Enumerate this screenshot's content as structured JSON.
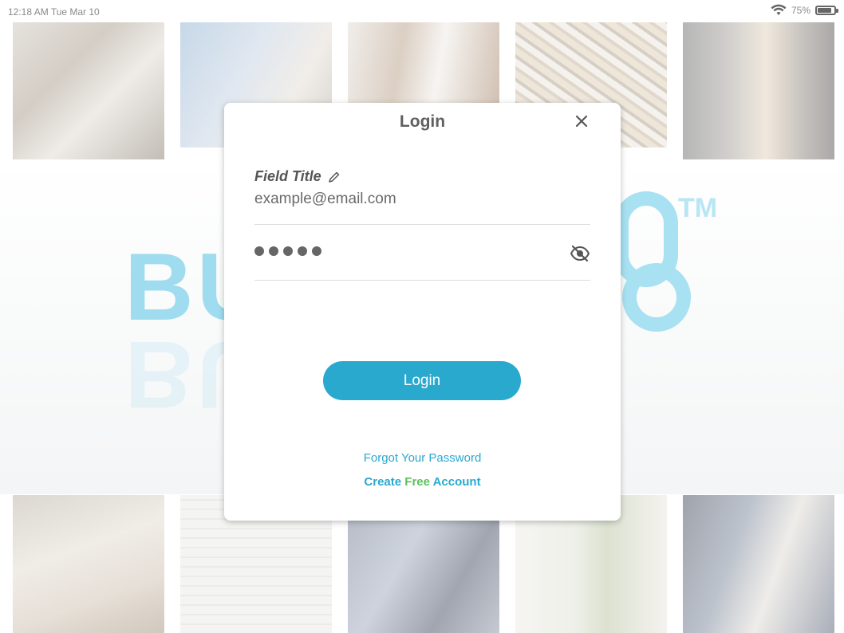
{
  "status_bar": {
    "time": "12:18 AM Tue Mar 10",
    "battery_percent": "75%",
    "battery_level": 0.75
  },
  "background": {
    "logo_text": "BU",
    "logo_tm": "TM"
  },
  "dialog": {
    "title": "Login",
    "field_title": "Field Title",
    "email_value": "example@email.com",
    "password_length": 5,
    "login_button": "Login",
    "forgot_password": "Forgot Your Password",
    "create_prefix": "Create",
    "create_free": "Free",
    "create_suffix": "Account"
  },
  "colors": {
    "accent": "#2aa9cf",
    "free_green": "#5cc05a",
    "logo_blue": "#9fdcef"
  },
  "icons": [
    "wifi-icon",
    "battery-icon",
    "close-icon",
    "pencil-icon",
    "eye-off-icon"
  ]
}
